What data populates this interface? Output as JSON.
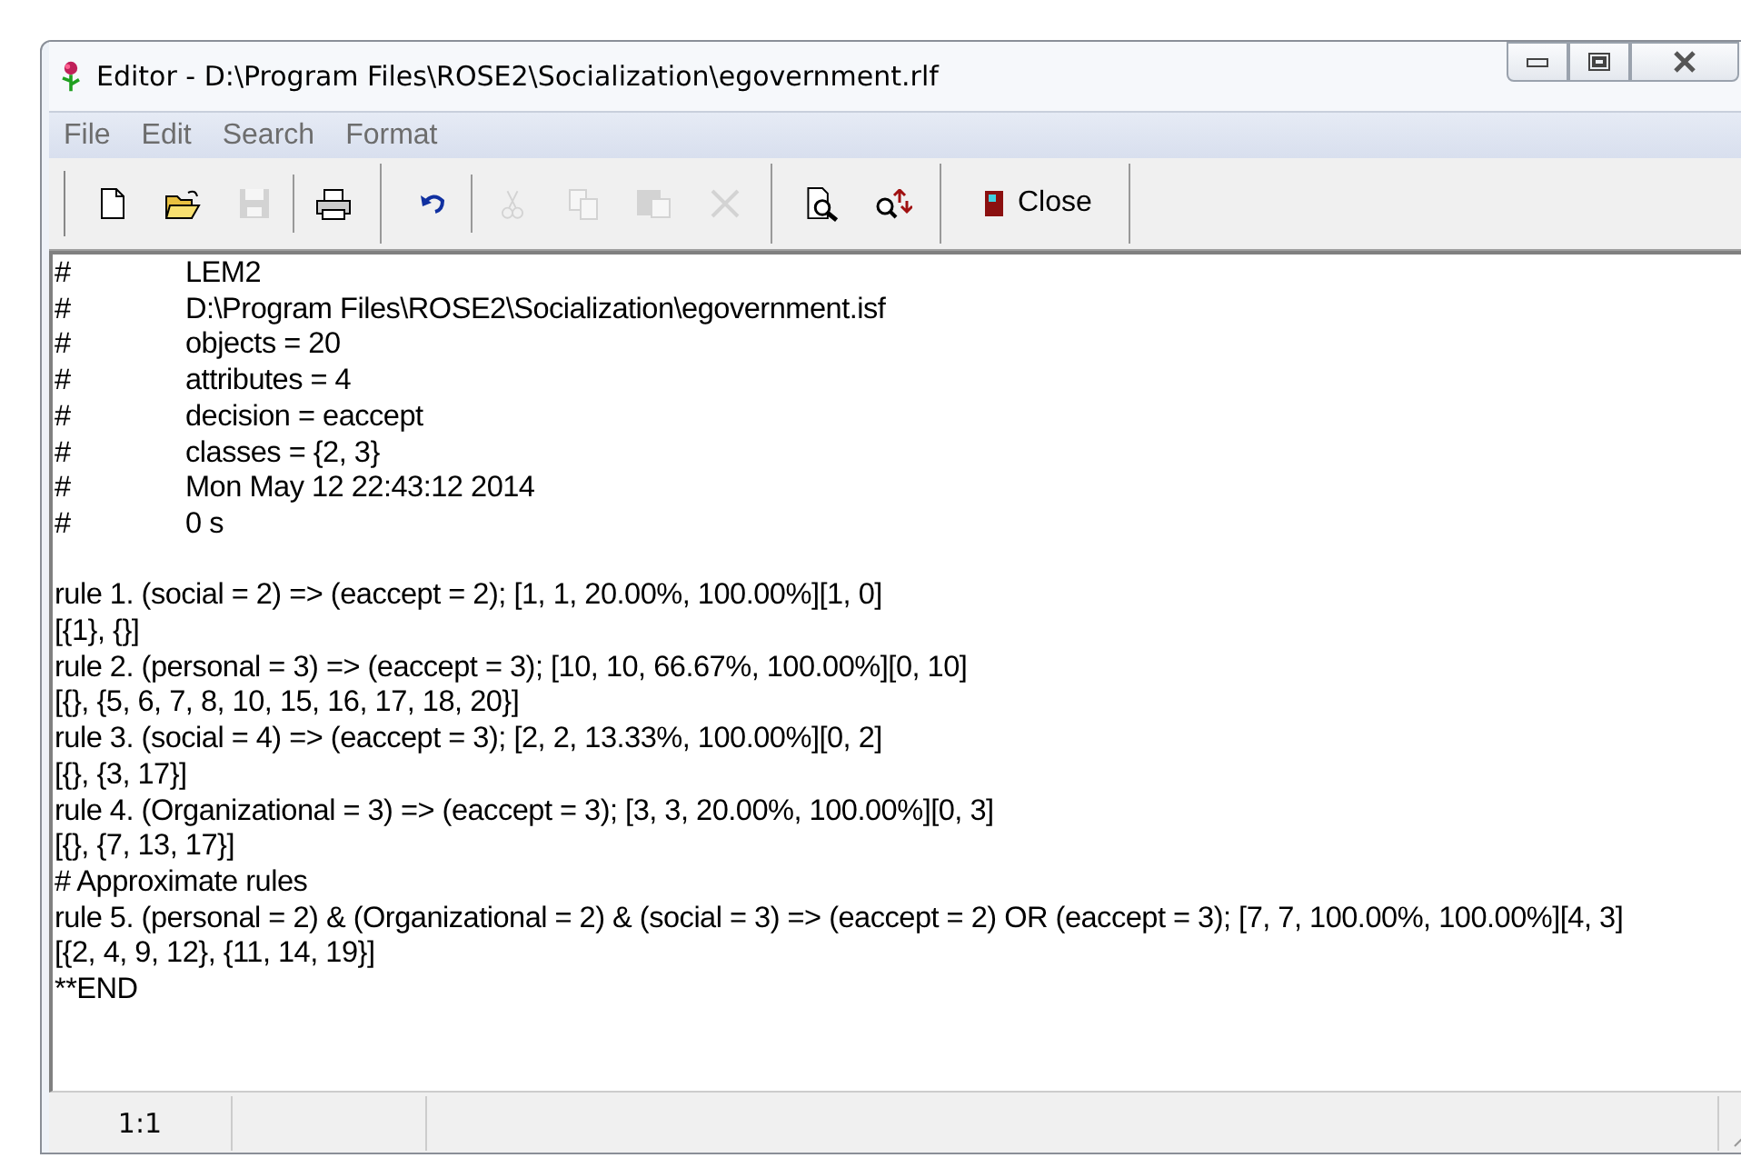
{
  "window": {
    "title": "Editor - D:\\Program Files\\ROSE2\\Socialization\\egovernment.rlf"
  },
  "menu": [
    "File",
    "Edit",
    "Search",
    "Format"
  ],
  "toolbar": [
    {
      "kind": "new",
      "disabled": false
    },
    {
      "kind": "open",
      "disabled": false
    },
    {
      "kind": "save",
      "disabled": true
    },
    {
      "kind": "sep"
    },
    {
      "kind": "print",
      "disabled": false
    },
    {
      "kind": "group"
    },
    {
      "kind": "undo",
      "disabled": false
    },
    {
      "kind": "sep"
    },
    {
      "kind": "cut",
      "disabled": true
    },
    {
      "kind": "copy",
      "disabled": true
    },
    {
      "kind": "paste",
      "disabled": true
    },
    {
      "kind": "delete",
      "disabled": true
    },
    {
      "kind": "group"
    },
    {
      "kind": "preview",
      "disabled": false
    },
    {
      "kind": "replace",
      "disabled": false
    },
    {
      "kind": "group"
    },
    {
      "kind": "close",
      "label": "Close",
      "disabled": false
    }
  ],
  "header": [
    {
      "mark": "#",
      "text": "LEM2"
    },
    {
      "mark": "#",
      "text": "D:\\Program Files\\ROSE2\\Socialization\\egovernment.isf"
    },
    {
      "mark": "#",
      "text": "objects = 20"
    },
    {
      "mark": "#",
      "text": "attributes = 4"
    },
    {
      "mark": "#",
      "text": "decision = eaccept"
    },
    {
      "mark": "#",
      "text": "classes = {2, 3}"
    },
    {
      "mark": "#",
      "text": "Mon May 12 22:43:12 2014"
    },
    {
      "mark": "#",
      "text": "0 s"
    }
  ],
  "lines": [
    "rule 1. (social = 2) => (eaccept = 2); [1, 1, 20.00%, 100.00%][1, 0]",
    "[{1}, {}]",
    "rule 2. (personal = 3) => (eaccept = 3); [10, 10, 66.67%, 100.00%][0, 10]",
    "[{}, {5, 6, 7, 8, 10, 15, 16, 17, 18, 20}]",
    "rule 3. (social = 4) => (eaccept = 3); [2, 2, 13.33%, 100.00%][0, 2]",
    "[{}, {3, 17}]",
    "rule 4. (Organizational = 3) => (eaccept = 3); [3, 3, 20.00%, 100.00%][0, 3]",
    "[{}, {7, 13, 17}]",
    "# Approximate rules",
    "rule 5. (personal = 2) & (Organizational = 2) & (social = 3) => (eaccept = 2) OR (eaccept = 3); [7, 7, 100.00%, 100.00%][4, 3]",
    "[{2, 4, 9, 12}, {11, 14, 19}]",
    "**END"
  ],
  "status_bar": {
    "position": "1:1"
  }
}
